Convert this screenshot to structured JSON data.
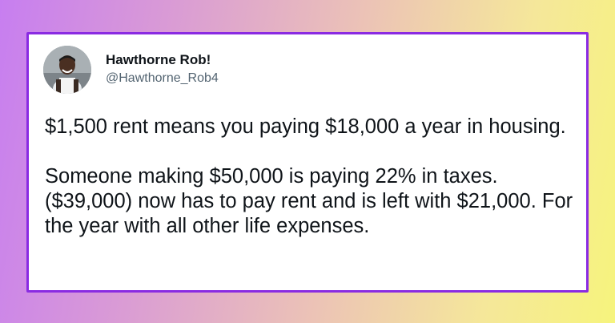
{
  "author": {
    "name": "Hawthorne Rob!",
    "handle": "@Hawthorne_Rob4",
    "avatar_icon": "profile-photo"
  },
  "tweet": {
    "paragraph1": "$1,500 rent means you paying $18,000 a year in housing.",
    "paragraph2": "Someone making $50,000 is paying 22% in taxes. ($39,000) now has to pay rent and is left with $21,000. For the year with all other life expenses."
  },
  "colors": {
    "border": "#8a2be2",
    "text": "#0f1419",
    "handle": "#536471"
  }
}
